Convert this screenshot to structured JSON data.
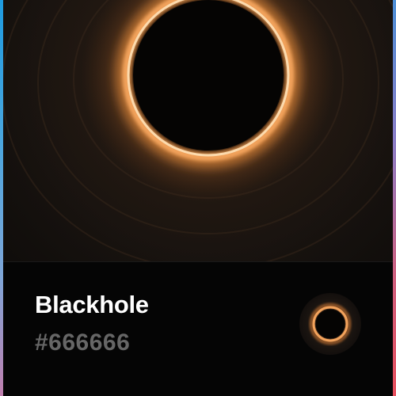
{
  "card": {
    "title": "Blackhole",
    "color_hex": "#666666",
    "image_subject": "blackhole",
    "swatch_icon": "blackhole-thumbnail-icon"
  },
  "colors": {
    "ring": "#f3a35c",
    "ring_core": "#ffe2b8",
    "background": "#050505",
    "edge_left": "#1e9be0",
    "edge_right": "#e8505e"
  }
}
